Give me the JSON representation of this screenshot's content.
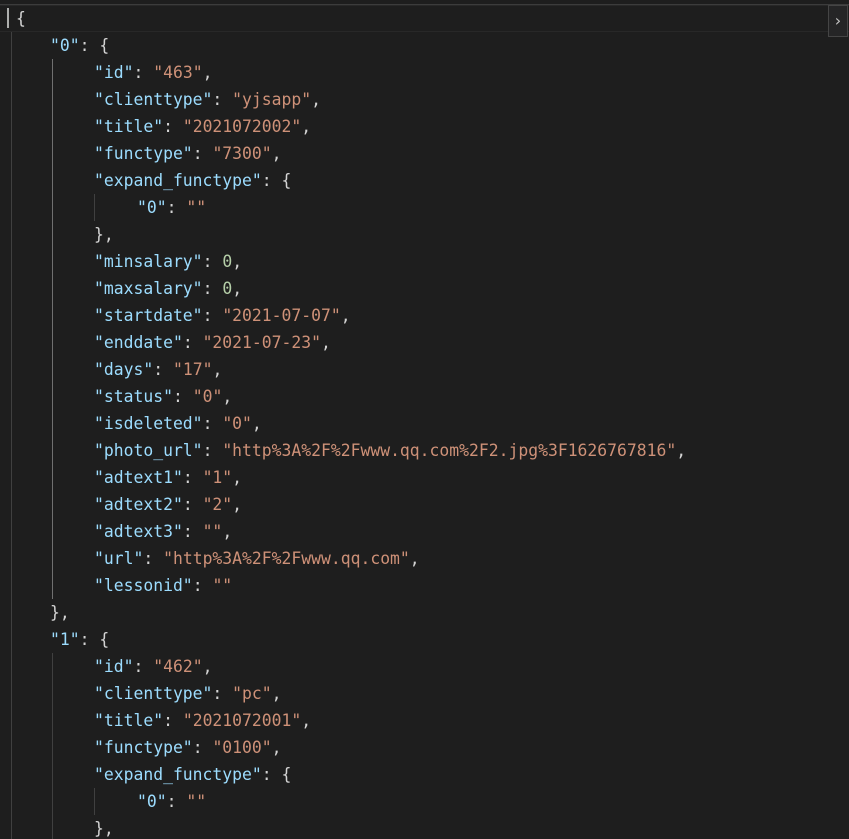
{
  "find_widget": {
    "toggle_icon": "›"
  },
  "code": {
    "open_root": "{",
    "entries": [
      {
        "key": "\"0\"",
        "open": "{",
        "fields": [
          {
            "key": "\"id\"",
            "value": "\"463\""
          },
          {
            "key": "\"clienttype\"",
            "value": "\"yjsapp\""
          },
          {
            "key": "\"title\"",
            "value": "\"2021072002\""
          },
          {
            "key": "\"functype\"",
            "value": "\"7300\""
          }
        ],
        "expand": {
          "key": "\"expand_functype\"",
          "open": "{",
          "inner_key": "\"0\"",
          "inner_value": "\"\"",
          "close": "},"
        },
        "fields2": [
          {
            "key": "\"minsalary\"",
            "value": "0"
          },
          {
            "key": "\"maxsalary\"",
            "value": "0"
          },
          {
            "key": "\"startdate\"",
            "value": "\"2021-07-07\""
          },
          {
            "key": "\"enddate\"",
            "value": "\"2021-07-23\""
          },
          {
            "key": "\"days\"",
            "value": "\"17\""
          },
          {
            "key": "\"status\"",
            "value": "\"0\""
          },
          {
            "key": "\"isdeleted\"",
            "value": "\"0\""
          },
          {
            "key": "\"photo_url\"",
            "value": "\"http%3A%2F%2Fwww.qq.com%2F2.jpg%3F1626767816\""
          },
          {
            "key": "\"adtext1\"",
            "value": "\"1\""
          },
          {
            "key": "\"adtext2\"",
            "value": "\"2\""
          },
          {
            "key": "\"adtext3\"",
            "value": "\"\""
          },
          {
            "key": "\"url\"",
            "value": "\"http%3A%2F%2Fwww.qq.com\""
          },
          {
            "key": "\"lessonid\"",
            "value": "\"\""
          }
        ],
        "close": "},"
      },
      {
        "key": "\"1\"",
        "open": "{",
        "fields": [
          {
            "key": "\"id\"",
            "value": "\"462\""
          },
          {
            "key": "\"clienttype\"",
            "value": "\"pc\""
          },
          {
            "key": "\"title\"",
            "value": "\"2021072001\""
          },
          {
            "key": "\"functype\"",
            "value": "\"0100\""
          }
        ],
        "expand": {
          "key": "\"expand_functype\"",
          "open": "{",
          "inner_key": "\"0\"",
          "inner_value": "\"\"",
          "close": "},"
        }
      }
    ]
  },
  "colors": {
    "background": "#1e1e1e",
    "key": "#9cdcfe",
    "string": "#ce9178",
    "number": "#b5cea8",
    "punctuation": "#d4d4d4"
  }
}
